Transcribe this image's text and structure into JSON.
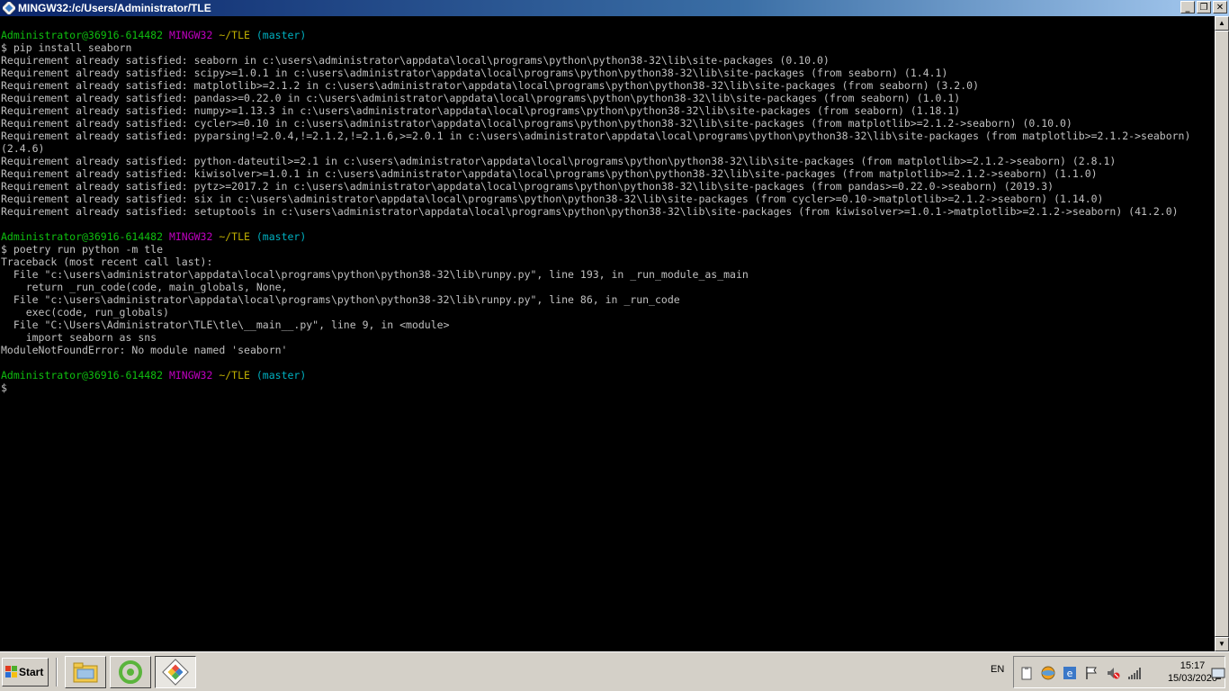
{
  "window": {
    "title": "MINGW32:/c/Users/Administrator/TLE"
  },
  "terminal": {
    "lines": [
      [
        {
          "t": "Administrator@36916-614482 ",
          "c": "g"
        },
        {
          "t": "MINGW32 ",
          "c": "m"
        },
        {
          "t": "~/TLE ",
          "c": "y"
        },
        {
          "t": "(master)",
          "c": "c"
        }
      ],
      [
        {
          "t": "$ pip install seaborn"
        }
      ],
      [
        {
          "t": "Requirement already satisfied: seaborn in c:\\users\\administrator\\appdata\\local\\programs\\python\\python38-32\\lib\\site-packages (0.10.0)"
        }
      ],
      [
        {
          "t": "Requirement already satisfied: scipy>=1.0.1 in c:\\users\\administrator\\appdata\\local\\programs\\python\\python38-32\\lib\\site-packages (from seaborn) (1.4.1)"
        }
      ],
      [
        {
          "t": "Requirement already satisfied: matplotlib>=2.1.2 in c:\\users\\administrator\\appdata\\local\\programs\\python\\python38-32\\lib\\site-packages (from seaborn) (3.2.0)"
        }
      ],
      [
        {
          "t": "Requirement already satisfied: pandas>=0.22.0 in c:\\users\\administrator\\appdata\\local\\programs\\python\\python38-32\\lib\\site-packages (from seaborn) (1.0.1)"
        }
      ],
      [
        {
          "t": "Requirement already satisfied: numpy>=1.13.3 in c:\\users\\administrator\\appdata\\local\\programs\\python\\python38-32\\lib\\site-packages (from seaborn) (1.18.1)"
        }
      ],
      [
        {
          "t": "Requirement already satisfied: cycler>=0.10 in c:\\users\\administrator\\appdata\\local\\programs\\python\\python38-32\\lib\\site-packages (from matplotlib>=2.1.2->seaborn) (0.10.0)"
        }
      ],
      [
        {
          "t": "Requirement already satisfied: pyparsing!=2.0.4,!=2.1.2,!=2.1.6,>=2.0.1 in c:\\users\\administrator\\appdata\\local\\programs\\python\\python38-32\\lib\\site-packages (from matplotlib>=2.1.2->seaborn)"
        }
      ],
      [
        {
          "t": "(2.4.6)"
        }
      ],
      [
        {
          "t": "Requirement already satisfied: python-dateutil>=2.1 in c:\\users\\administrator\\appdata\\local\\programs\\python\\python38-32\\lib\\site-packages (from matplotlib>=2.1.2->seaborn) (2.8.1)"
        }
      ],
      [
        {
          "t": "Requirement already satisfied: kiwisolver>=1.0.1 in c:\\users\\administrator\\appdata\\local\\programs\\python\\python38-32\\lib\\site-packages (from matplotlib>=2.1.2->seaborn) (1.1.0)"
        }
      ],
      [
        {
          "t": "Requirement already satisfied: pytz>=2017.2 in c:\\users\\administrator\\appdata\\local\\programs\\python\\python38-32\\lib\\site-packages (from pandas>=0.22.0->seaborn) (2019.3)"
        }
      ],
      [
        {
          "t": "Requirement already satisfied: six in c:\\users\\administrator\\appdata\\local\\programs\\python\\python38-32\\lib\\site-packages (from cycler>=0.10->matplotlib>=2.1.2->seaborn) (1.14.0)"
        }
      ],
      [
        {
          "t": "Requirement already satisfied: setuptools in c:\\users\\administrator\\appdata\\local\\programs\\python\\python38-32\\lib\\site-packages (from kiwisolver>=1.0.1->matplotlib>=2.1.2->seaborn) (41.2.0)"
        }
      ],
      [
        {
          "t": ""
        }
      ],
      [
        {
          "t": "Administrator@36916-614482 ",
          "c": "g"
        },
        {
          "t": "MINGW32 ",
          "c": "m"
        },
        {
          "t": "~/TLE ",
          "c": "y"
        },
        {
          "t": "(master)",
          "c": "c"
        }
      ],
      [
        {
          "t": "$ poetry run python -m tle"
        }
      ],
      [
        {
          "t": "Traceback (most recent call last):"
        }
      ],
      [
        {
          "t": "  File \"c:\\users\\administrator\\appdata\\local\\programs\\python\\python38-32\\lib\\runpy.py\", line 193, in _run_module_as_main"
        }
      ],
      [
        {
          "t": "    return _run_code(code, main_globals, None,"
        }
      ],
      [
        {
          "t": "  File \"c:\\users\\administrator\\appdata\\local\\programs\\python\\python38-32\\lib\\runpy.py\", line 86, in _run_code"
        }
      ],
      [
        {
          "t": "    exec(code, run_globals)"
        }
      ],
      [
        {
          "t": "  File \"C:\\Users\\Administrator\\TLE\\tle\\__main__.py\", line 9, in <module>"
        }
      ],
      [
        {
          "t": "    import seaborn as sns"
        }
      ],
      [
        {
          "t": "ModuleNotFoundError: No module named 'seaborn'"
        }
      ],
      [
        {
          "t": ""
        }
      ],
      [
        {
          "t": "Administrator@36916-614482 ",
          "c": "g"
        },
        {
          "t": "MINGW32 ",
          "c": "m"
        },
        {
          "t": "~/TLE ",
          "c": "y"
        },
        {
          "t": "(master)",
          "c": "c"
        }
      ],
      [
        {
          "t": "$"
        }
      ]
    ]
  },
  "taskbar": {
    "start_label": "Start",
    "language": "EN",
    "time": "15:17",
    "date": "15/03/2020"
  }
}
